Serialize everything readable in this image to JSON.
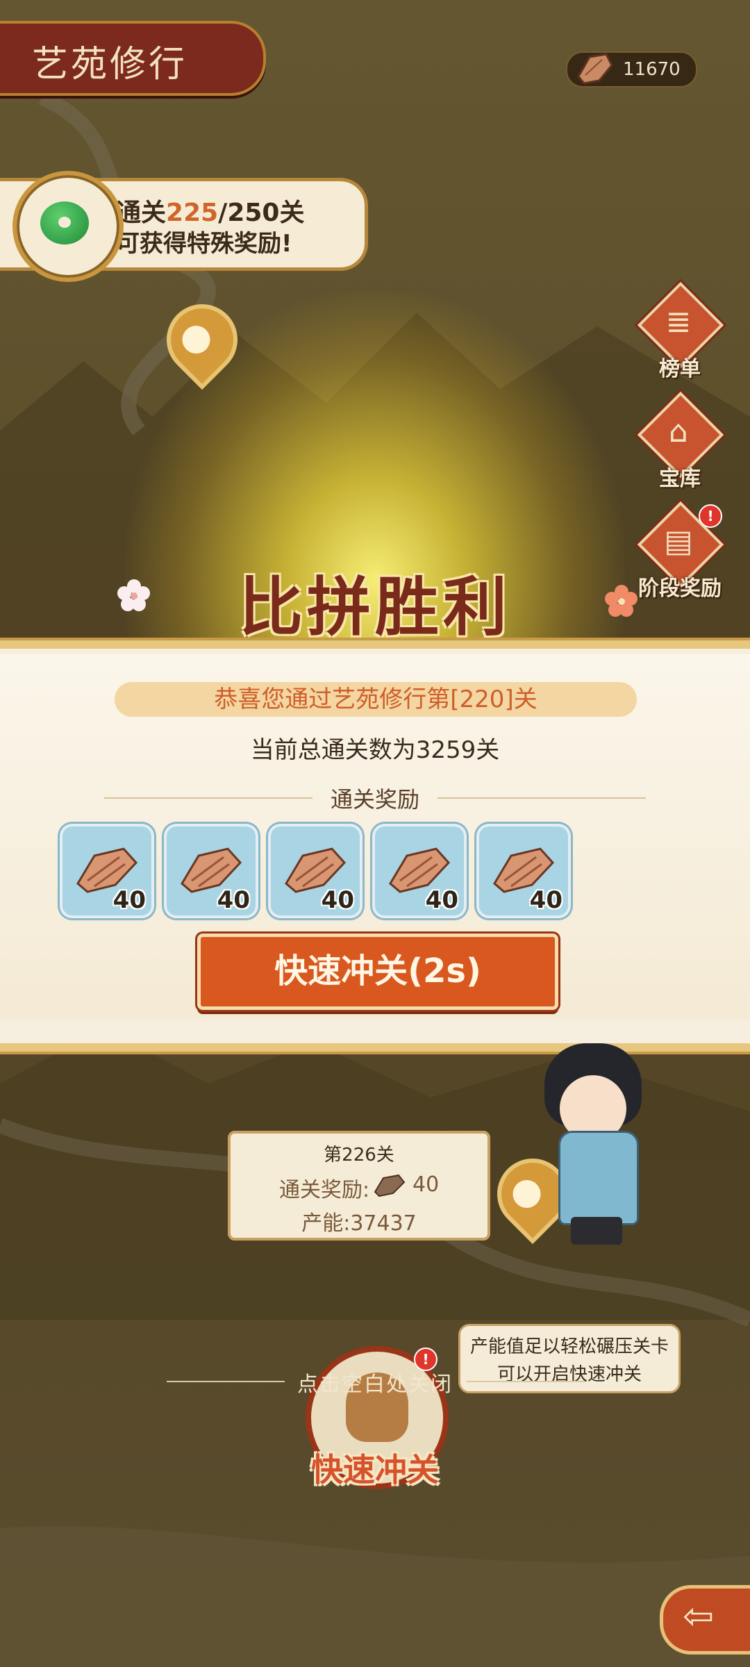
{
  "header": {
    "title": "艺苑修行",
    "currency_value": "11670"
  },
  "goal": {
    "prefix": "通关",
    "current": "225",
    "total_part": "/250关",
    "line2": "可获得特殊奖励!"
  },
  "side_buttons": [
    {
      "label": "榜单",
      "icon": "ranking-scroll-icon"
    },
    {
      "label": "宝库",
      "icon": "treasury-house-icon"
    },
    {
      "label": "阶段奖励",
      "icon": "stage-reward-chest-icon",
      "badge": "!"
    }
  ],
  "victory": {
    "title": "比拼胜利",
    "congrats": "恭喜您通过艺苑修行第[220]关",
    "total": "当前总通关数为3259关",
    "rewards_title": "通关奖励",
    "rewards": [
      {
        "icon": "wood-material-icon",
        "count": "40"
      },
      {
        "icon": "wood-material-icon",
        "count": "40"
      },
      {
        "icon": "wood-material-icon",
        "count": "40"
      },
      {
        "icon": "wood-material-icon",
        "count": "40"
      },
      {
        "icon": "wood-material-icon",
        "count": "40"
      }
    ],
    "quick_button": "快速冲关(2s)"
  },
  "level_card": {
    "title": "第226关",
    "reward_label": "通关奖励:",
    "reward_value": "40",
    "capacity": "产能:37437"
  },
  "hint_bubble": {
    "line1": "产能值足以轻松碾压关卡",
    "line2": "可以开启快速冲关"
  },
  "close_hint": "点击空白处关闭",
  "quick_rush_label": "快速冲关",
  "colors": {
    "accent_red": "#7d2a1e",
    "button_orange": "#d8581f",
    "highlight": "#d0652b",
    "gold": "#e7c77e"
  }
}
